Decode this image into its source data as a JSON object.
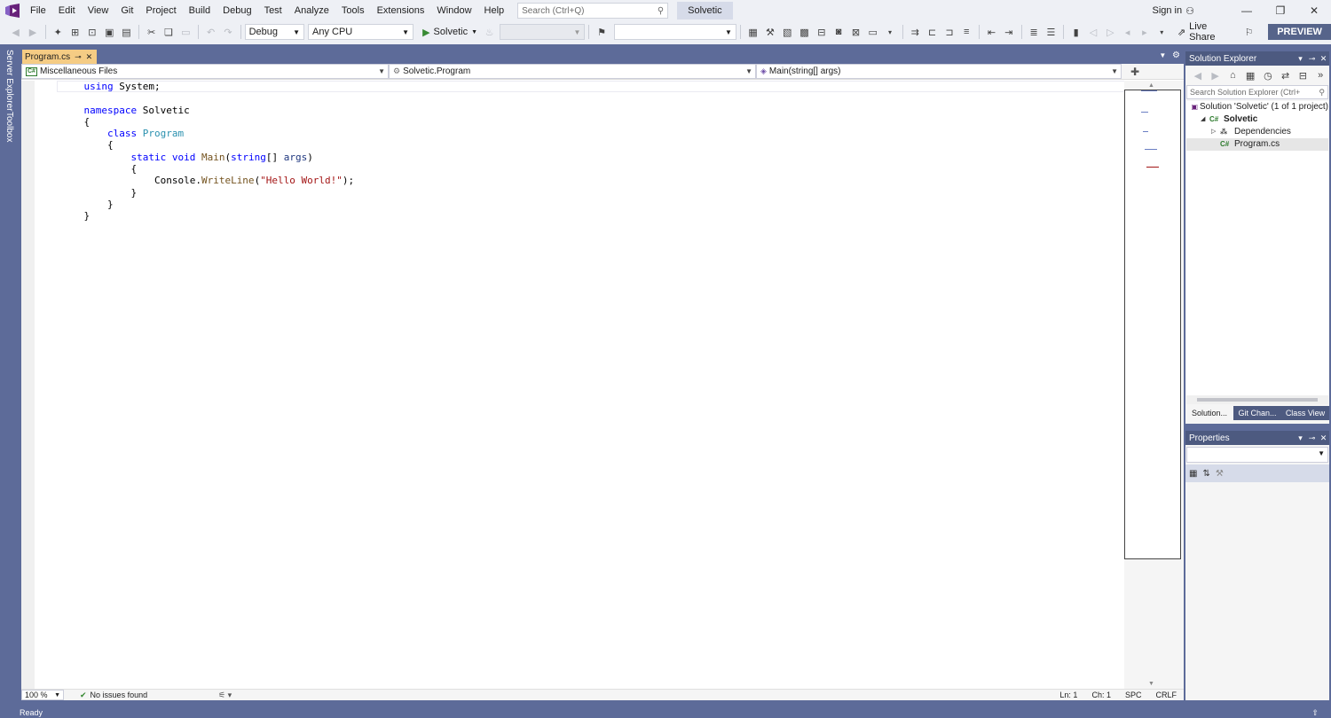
{
  "menu": [
    "File",
    "Edit",
    "View",
    "Git",
    "Project",
    "Build",
    "Debug",
    "Test",
    "Analyze",
    "Tools",
    "Extensions",
    "Window",
    "Help"
  ],
  "search": {
    "placeholder": "Search (Ctrl+Q)"
  },
  "solution_name": "Solvetic",
  "account": {
    "sign_in": "Sign in"
  },
  "toolbar": {
    "config": "Debug",
    "platform": "Any CPU",
    "start_label": "Solvetic",
    "live_share": "Live Share",
    "preview": "PREVIEW"
  },
  "document_tab": {
    "title": "Program.cs"
  },
  "left_tabs": [
    "Server Explorer",
    "Toolbox"
  ],
  "navbar": {
    "project": "Miscellaneous Files",
    "type": "Solvetic.Program",
    "member": "Main(string[] args)"
  },
  "code_lines": [
    [
      {
        "t": "    "
      },
      {
        "t": "using",
        "c": "kw"
      },
      {
        "t": " System;"
      }
    ],
    [
      {
        "t": ""
      }
    ],
    [
      {
        "t": "    "
      },
      {
        "t": "namespace",
        "c": "kw"
      },
      {
        "t": " Solvetic"
      }
    ],
    [
      {
        "t": "    {"
      }
    ],
    [
      {
        "t": "        "
      },
      {
        "t": "class",
        "c": "kw"
      },
      {
        "t": " "
      },
      {
        "t": "Program",
        "c": "ty"
      }
    ],
    [
      {
        "t": "        {"
      }
    ],
    [
      {
        "t": "            "
      },
      {
        "t": "static",
        "c": "kw"
      },
      {
        "t": " "
      },
      {
        "t": "void",
        "c": "kw"
      },
      {
        "t": " "
      },
      {
        "t": "Main",
        "c": "mth"
      },
      {
        "t": "("
      },
      {
        "t": "string",
        "c": "kw"
      },
      {
        "t": "[] "
      },
      {
        "t": "args",
        "c": "prm"
      },
      {
        "t": ")"
      }
    ],
    [
      {
        "t": "            {"
      }
    ],
    [
      {
        "t": "                Console."
      },
      {
        "t": "WriteLine",
        "c": "mth"
      },
      {
        "t": "("
      },
      {
        "t": "\"Hello World!\"",
        "c": "str"
      },
      {
        "t": ");"
      }
    ],
    [
      {
        "t": "            }"
      }
    ],
    [
      {
        "t": "        }"
      }
    ],
    [
      {
        "t": "    }"
      }
    ]
  ],
  "editor_status": {
    "zoom": "100 %",
    "issues": "No issues found",
    "line": "Ln: 1",
    "col": "Ch: 1",
    "whitespace": "SPC",
    "line_ending": "CRLF"
  },
  "solution_explorer": {
    "title": "Solution Explorer",
    "search_placeholder": "Search Solution Explorer (Ctrl+",
    "tree": [
      {
        "label": "Solution 'Solvetic' (1 of 1 project)",
        "indent": 0,
        "expander": "",
        "icon": "solution",
        "bold": false
      },
      {
        "label": "Solvetic",
        "indent": 1,
        "expander": "◢",
        "icon": "csproj",
        "bold": true
      },
      {
        "label": "Dependencies",
        "indent": 2,
        "expander": "▷",
        "icon": "dependencies",
        "bold": false
      },
      {
        "label": "Program.cs",
        "indent": 2,
        "expander": "",
        "icon": "csfile",
        "bold": false
      }
    ],
    "bottom_tabs": [
      "Solution...",
      "Git Chan...",
      "Class View"
    ]
  },
  "properties": {
    "title": "Properties"
  },
  "status_bar": {
    "text": "Ready"
  }
}
